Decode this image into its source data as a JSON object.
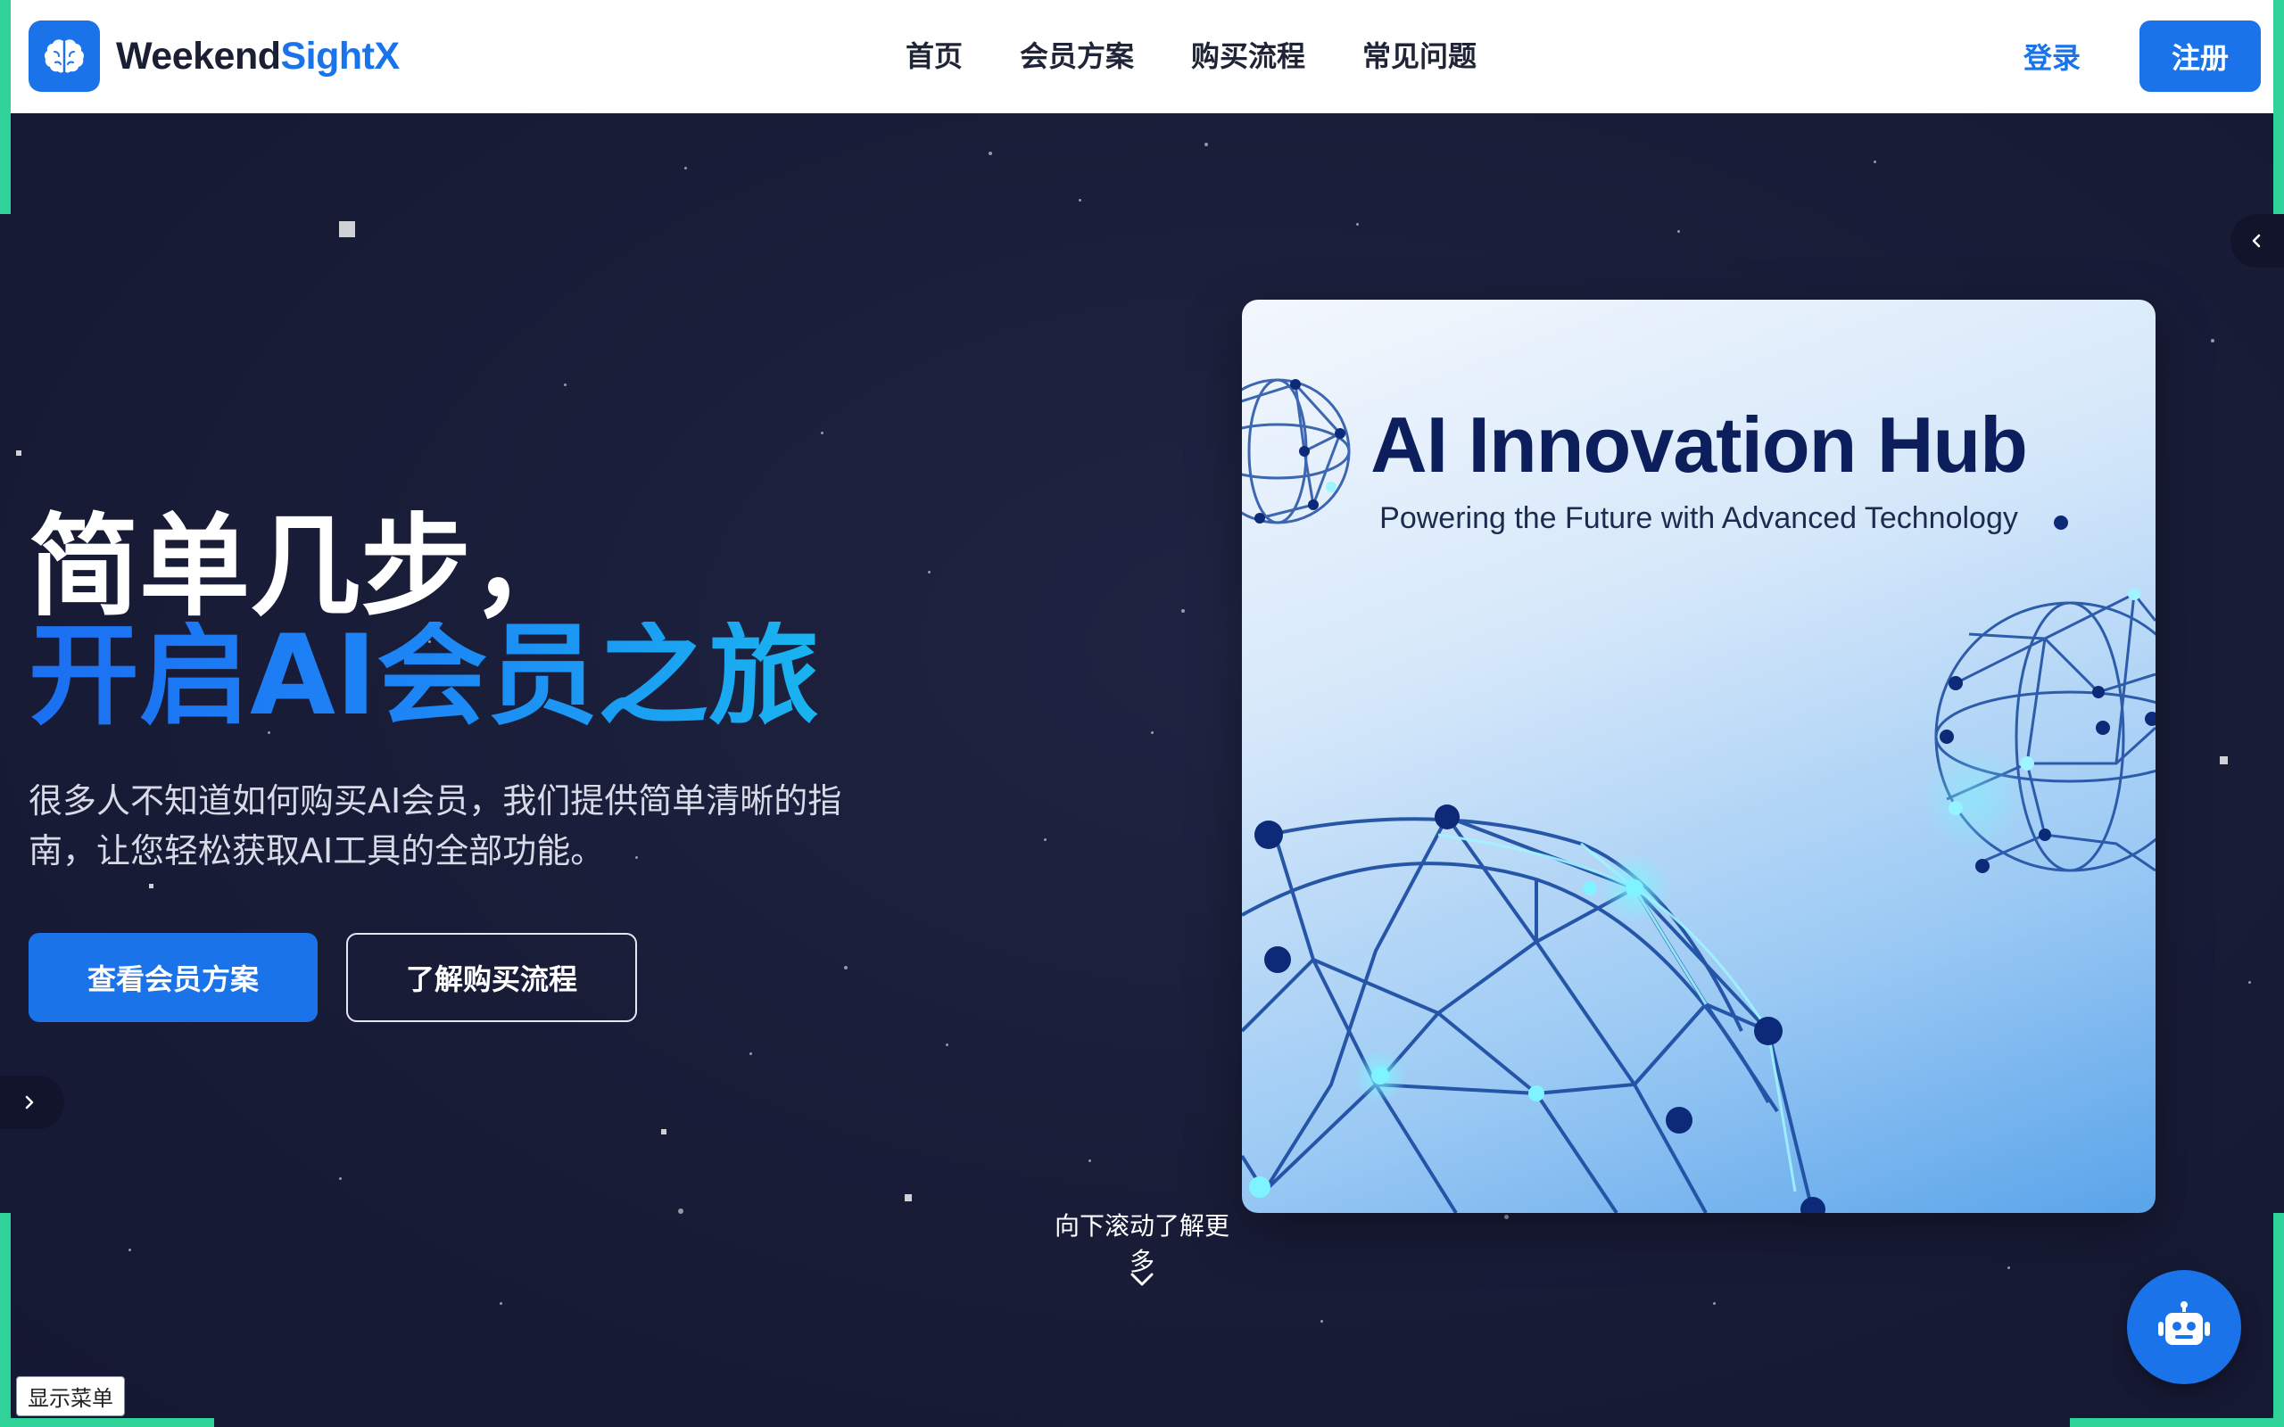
{
  "brand": {
    "name_part1": "Weekend",
    "name_part2": "SightX",
    "icon": "brain-icon"
  },
  "nav": {
    "items": [
      {
        "label": "首页"
      },
      {
        "label": "会员方案"
      },
      {
        "label": "购买流程"
      },
      {
        "label": "常见问题"
      }
    ],
    "login_label": "登录",
    "signup_label": "注册"
  },
  "hero": {
    "title_line1": "简单几步，",
    "title_line2": "开启AI会员之旅",
    "description": "很多人不知道如何购买AI会员，我们提供简单清晰的指南，让您轻松获取AI工具的全部功能。",
    "primary_button": "查看会员方案",
    "secondary_button": "了解购买流程",
    "image": {
      "title": "AI Innovation Hub",
      "subtitle": "Powering the Future with Advanced Technology"
    }
  },
  "scroll_hint": "向下滚动了解更多",
  "menu_chip": "显示菜单",
  "icons": {
    "collapse_right": "chevron-left-icon",
    "expand_left": "chevron-right-icon",
    "scroll_down": "chevron-down-icon",
    "chat_bot": "robot-icon"
  },
  "colors": {
    "accent": "#1a73e8",
    "background": "#181c37",
    "frame": "#2fd39a",
    "card_title": "#0c1f5c"
  }
}
